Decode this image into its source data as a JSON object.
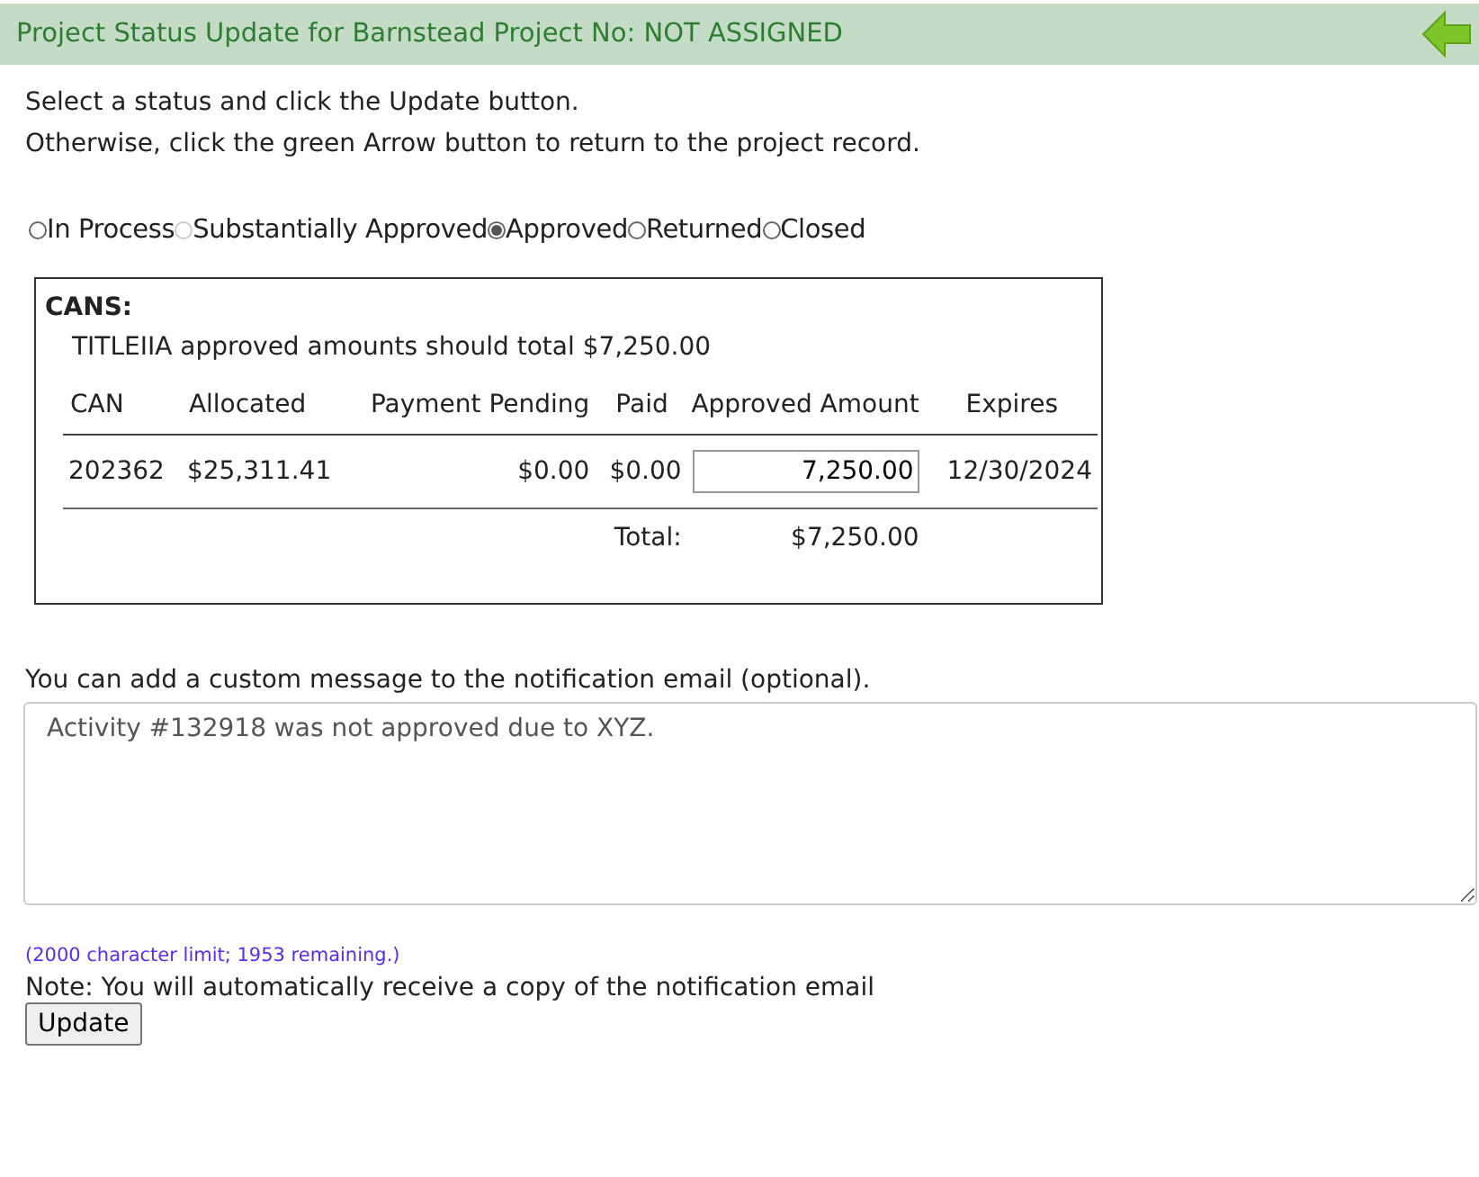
{
  "header": {
    "title": "Project  Status Update for Barnstead Project No: NOT ASSIGNED"
  },
  "instructions": [
    "Select a status and click the Update button.",
    "Otherwise, click the green Arrow button to return to the project  record."
  ],
  "statuses": [
    {
      "label": "In Process",
      "selected": false,
      "disabled": false
    },
    {
      "label": "Substantially Approved",
      "selected": false,
      "disabled": true
    },
    {
      "label": "Approved",
      "selected": true,
      "disabled": false
    },
    {
      "label": "Returned",
      "selected": false,
      "disabled": false
    },
    {
      "label": "Closed",
      "selected": false,
      "disabled": false
    }
  ],
  "cans": {
    "title": "CANS:",
    "note": "TITLEIIA approved amounts should total $7,250.00",
    "columns": [
      "CAN",
      "Allocated",
      "Payment Pending",
      "Paid",
      "Approved Amount",
      "Expires"
    ],
    "rows": [
      {
        "can": "202362",
        "allocated": "$25,311.41",
        "payment_pending": "$0.00",
        "paid": "$0.00",
        "approved_amount": "7,250.00",
        "expires": "12/30/2024"
      }
    ],
    "total_label": "Total:",
    "total": "$7,250.00"
  },
  "message": {
    "label": "You can add a custom message to the notification email (optional).",
    "value": "Activity #132918 was not approved due to XYZ.",
    "limit_note": "(2000 character limit; 1953 remaining.)"
  },
  "note": "Note: You will automatically receive a copy of the notification email",
  "update_button": "Update"
}
